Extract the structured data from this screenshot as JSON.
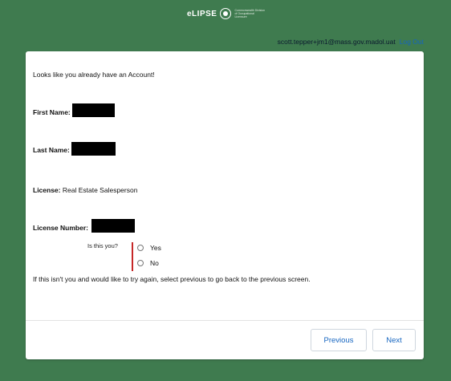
{
  "header": {
    "app_name": "eLIPSE",
    "agency": "Commonwealth Division of Occupational Licensure",
    "logo_icon": "state-seal-icon"
  },
  "user_bar": {
    "email": "scott.tepper+jm1@mass.gov.madol.uat",
    "logout_label": "Log Out"
  },
  "card": {
    "intro": "Looks like you already have an Account!",
    "first_name_label": "First Name:",
    "last_name_label": "Last Name:",
    "license_label": "License:",
    "license_value": "Real Estate Salesperson",
    "license_number_label": "License Number:",
    "question": "Is this you?",
    "options": [
      "Yes",
      "No"
    ],
    "help_text": "If this isn't you and would like to try again, select previous to go back to the previous screen."
  },
  "footer": {
    "previous_label": "Previous",
    "next_label": "Next"
  },
  "colors": {
    "background": "#3f7b4f",
    "accent": "#1565c0",
    "required_bar": "#c62828"
  }
}
